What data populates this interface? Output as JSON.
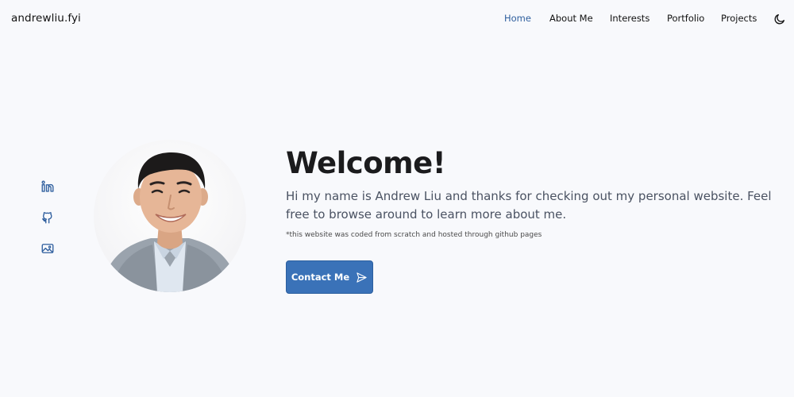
{
  "header": {
    "logo": "andrewliu.fyi",
    "nav": [
      {
        "label": "Home",
        "active": true
      },
      {
        "label": "About Me",
        "active": false
      },
      {
        "label": "Interests",
        "active": false
      },
      {
        "label": "Portfolio",
        "active": false
      },
      {
        "label": "Projects",
        "active": false
      }
    ],
    "theme_toggle_icon": "moon-icon"
  },
  "social": {
    "icons": [
      "linkedin-icon",
      "github-icon",
      "image-icon"
    ],
    "color": "#2f5f9e"
  },
  "hero": {
    "title": "Welcome!",
    "description": "Hi my name is Andrew Liu and thanks for checking out my personal website. Feel free to browse around to learn more about me.",
    "note": "*this website was coded from scratch and hosted through github pages",
    "contact_label": "Contact Me",
    "contact_icon": "send-icon",
    "button_color": "#3a72b8"
  },
  "colors": {
    "background": "#f8f9fc",
    "nav_active": "#2f5f9e",
    "text": "#1b1b1d",
    "description": "#4a5262"
  }
}
